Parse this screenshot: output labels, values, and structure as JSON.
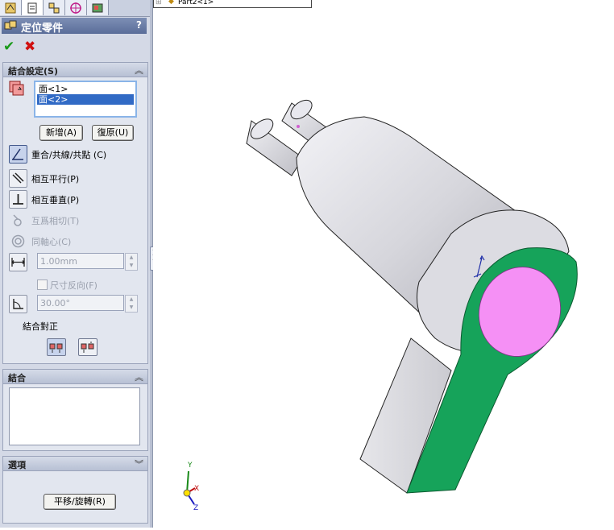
{
  "tabs": [
    {
      "icon": "feature-manager-icon"
    },
    {
      "icon": "property-manager-icon"
    },
    {
      "icon": "configuration-manager-icon"
    },
    {
      "icon": "dimxpert-manager-icon"
    },
    {
      "icon": "display-manager-icon"
    }
  ],
  "tree_tab_text": "Part2<1>",
  "header": {
    "title": "定位零件",
    "help": "?"
  },
  "actions": {
    "ok": "✔",
    "cancel": "✖"
  },
  "mate_selections": {
    "title": "結合設定(S)",
    "items": [
      "面<1>",
      "面<2>"
    ],
    "selected_index": 1,
    "add_label": "新增(A)",
    "undo_label": "復原(U)"
  },
  "mate_types": {
    "coincident": "重合/共線/共點 (C)",
    "parallel": "相互平行(P)",
    "perpendicular": "相互垂直(P)",
    "tangent": "互爲相切(T)",
    "concentric": "同軸心(C)",
    "distance_value": "1.00mm",
    "flip_dimension": "尺寸反向(F)",
    "angle_value": "30.00°",
    "alignment_label": "結合對正"
  },
  "mates_group": {
    "title": "結合"
  },
  "options_group": {
    "title": "選項",
    "move_rotate_label": "平移/旋轉(R)"
  },
  "triad": {
    "x": "X",
    "y": "Y",
    "z": "Z"
  },
  "colors": {
    "green_face": "#16a35a",
    "pink_face": "#f590f5",
    "body_gray": "#d8d8de",
    "header_blue": "#5a6d99"
  }
}
